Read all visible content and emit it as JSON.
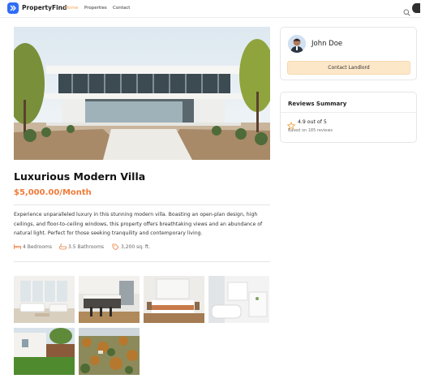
{
  "nav": {
    "brand": "PropertyFind",
    "links": [
      "Home",
      "Properties",
      "Contact"
    ],
    "active_index": 0,
    "accent": "#f6a04d",
    "logo_color": "#2f6df6"
  },
  "listing": {
    "title": "Luxurious Modern Villa",
    "price": "$5,000.00/Month",
    "description": "Experience unparalleled luxury in this stunning modern villa. Boasting an open-plan design, high ceilings, and floor-to-ceiling windows, this property offers breathtaking views and an abundance of natural light. Perfect for those seeking tranquility and contemporary living.",
    "features": [
      {
        "icon": "bed-icon",
        "label": "4 Bedrooms"
      },
      {
        "icon": "bath-icon",
        "label": "3.5 Bathrooms"
      },
      {
        "icon": "tag-icon",
        "label": "3,200 sq. ft."
      }
    ],
    "price_color": "#ef7c3a"
  },
  "gallery": [
    {
      "name": "living-room-photo"
    },
    {
      "name": "kitchen-photo"
    },
    {
      "name": "bedroom-photo"
    },
    {
      "name": "bathroom-photo"
    },
    {
      "name": "backyard-photo"
    },
    {
      "name": "aerial-view-photo"
    }
  ],
  "agent": {
    "name": "John Doe",
    "contact_label": "Contact Landlord"
  },
  "reviews": {
    "title": "Reviews Summary",
    "rating": "4.9 out of 5",
    "based_on": "Based on 185 reviews",
    "star_color": "#f2a33a"
  }
}
